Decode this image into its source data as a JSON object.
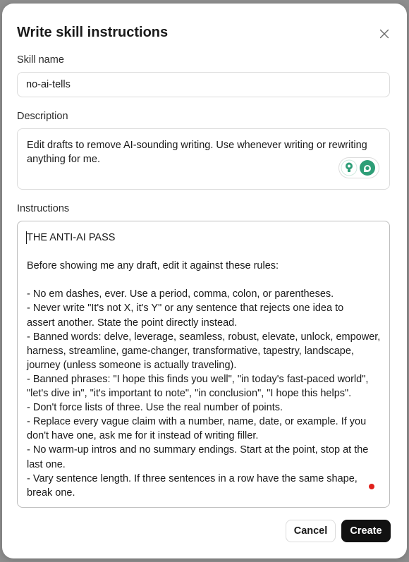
{
  "dialog": {
    "title": "Write skill instructions",
    "close_icon": "close-icon"
  },
  "skill_name": {
    "label": "Skill name",
    "value": "no-ai-tells"
  },
  "description": {
    "label": "Description",
    "value": "Edit drafts to remove AI-sounding writing. Use whenever writing or rewriting\nanything for me.",
    "extension_icons": [
      "lightbulb-icon",
      "grammar-assistant-icon"
    ]
  },
  "instructions": {
    "label": "Instructions",
    "value": "THE ANTI-AI PASS\n\nBefore showing me any draft, edit it against these rules:\n\n- No em dashes, ever. Use a period, comma, colon, or parentheses.\n- Never write \"It's not X, it's Y\" or any sentence that rejects one idea to\nassert another. State the point directly instead.\n- Banned words: delve, leverage, seamless, robust, elevate, unlock, empower,\nharness, streamline, game-changer, transformative, tapestry, landscape,\njourney (unless someone is actually traveling).\n- Banned phrases: \"I hope this finds you well\", \"in today's fast-paced world\",\n\"let's dive in\", \"it's important to note\", \"in conclusion\", \"I hope this helps\".\n- Don't force lists of three. Use the real number of points.\n- Replace every vague claim with a number, name, date, or example. If you\ndon't have one, ask me for it instead of writing filler.\n- No warm-up intros and no summary endings. Start at the point, stop at the\nlast one.\n- Vary sentence length. If three sentences in a row have the same shape,\nbreak one."
  },
  "actions": {
    "cancel_label": "Cancel",
    "create_label": "Create"
  },
  "colors": {
    "primary_button": "#111111",
    "backdrop": "#8e8e8e",
    "accent_green": "#2e9e77",
    "indicator_red": "#e0201b"
  }
}
